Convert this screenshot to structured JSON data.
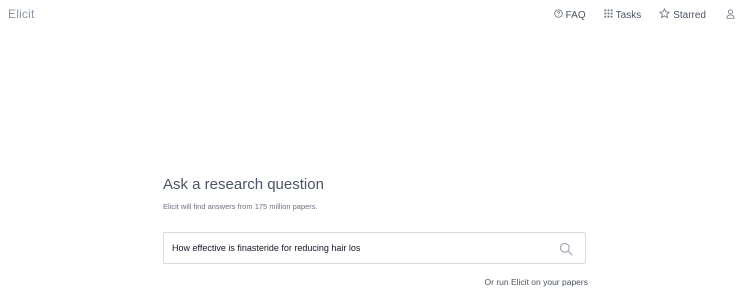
{
  "header": {
    "brand": "Elicit",
    "nav": {
      "faq": "FAQ",
      "tasks": "Tasks",
      "starred": "Starred"
    }
  },
  "main": {
    "title": "Ask a research question",
    "subtitle": "Elicit will find answers from 175 million papers.",
    "search": {
      "value": "How effective is finasteride for reducing hair los"
    },
    "run_link": "Or run Elicit on your papers"
  }
}
